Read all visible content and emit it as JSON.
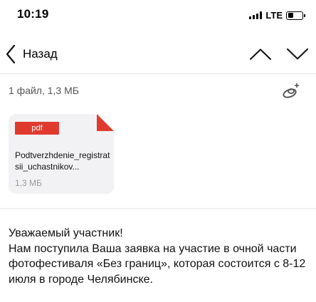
{
  "status_bar": {
    "time": "10:19",
    "network": "LTE",
    "battery_level": 0.4
  },
  "nav": {
    "back_label": "Назад",
    "back_icon": "chevron-left-icon",
    "prev_icon": "chevron-up-icon",
    "next_icon": "chevron-down-icon"
  },
  "attachments": {
    "summary": "1 файл, 1,3 МБ",
    "save_icon": "cloud-save-icon",
    "files": [
      {
        "type_badge": "pdf",
        "name": "Podtverzhdenie_registratsii_uchastnikov...",
        "size": "1,3 МБ"
      }
    ]
  },
  "message": {
    "greeting": "Уважаемый участник!",
    "body": "Нам поступила Ваша заявка на участие в очной части фотофестиваля «Без границ», которая состоится с 8-12 июля в городе Челябинске."
  },
  "colors": {
    "pdf_badge": "#e03a2f",
    "card_background": "#f2f2f4",
    "divider": "#e5e5e5",
    "muted_text": "#999999"
  }
}
